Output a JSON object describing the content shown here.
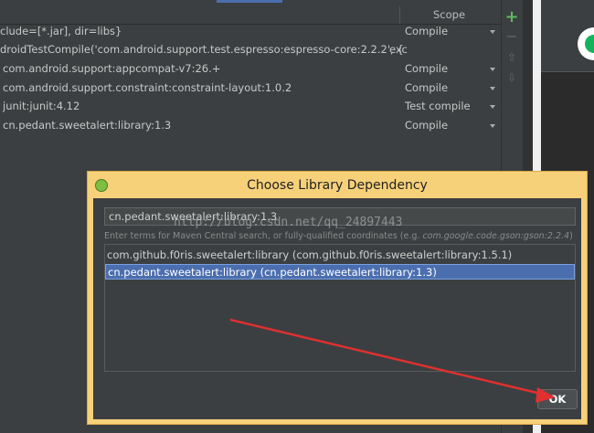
{
  "dependencies": {
    "scope_header": "Scope",
    "rows": [
      {
        "name": "clude=[*.jar], dir=libs}",
        "scope": "Compile"
      },
      {
        "name": "droidTestCompile('com.android.support.test.espresso:espresso-core:2.2.2', {",
        "scope": "",
        "overflow": "exc"
      },
      {
        "name": "com.android.support:appcompat-v7:26.+",
        "scope": "Compile"
      },
      {
        "name": "com.android.support.constraint:constraint-layout:1.0.2",
        "scope": "Compile"
      },
      {
        "name": "junit:junit:4.12",
        "scope": "Test compile"
      },
      {
        "name": "cn.pedant.sweetalert:library:1.3",
        "scope": "Compile"
      }
    ],
    "toolbar": {
      "add": "+",
      "remove": "−",
      "up": "⇧",
      "down": "⇩"
    }
  },
  "dialog": {
    "title": "Choose Library Dependency",
    "search_value": "cn.pedant.sweetalert:library:1.3",
    "hint_prefix": "Enter terms for Maven Central search, or fully-qualified coordinates (e.g. ",
    "hint_example": "com.google.code.gson:gson:2.2.4",
    "hint_suffix": ")",
    "results": [
      {
        "label": "com.github.f0ris.sweetalert:library (com.github.f0ris.sweetalert:library:1.5.1)",
        "selected": false
      },
      {
        "label": "cn.pedant.sweetalert:library (cn.pedant.sweetalert:library:1.3)",
        "selected": true
      }
    ],
    "ok_label": "OK"
  },
  "watermark": "http://blog.csdn.net/qq_24897443",
  "colors": {
    "selection": "#4b6eaf",
    "dialog_frame": "#f6d17a",
    "arrow": "#e03030",
    "add_icon": "#5fb95f"
  }
}
